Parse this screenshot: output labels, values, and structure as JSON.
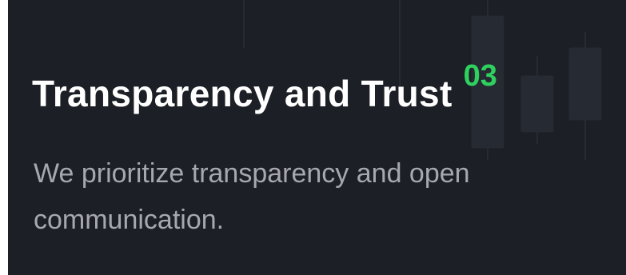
{
  "card": {
    "title": "Transparency and Trust",
    "number": "03",
    "description": "We prioritize transparency and open communication."
  },
  "colors": {
    "background": "#1c1f26",
    "title": "#ffffff",
    "accent": "#2fd15e",
    "description": "#a6a8ad"
  },
  "icons": {
    "background": "candlestick-chart-decoration"
  }
}
